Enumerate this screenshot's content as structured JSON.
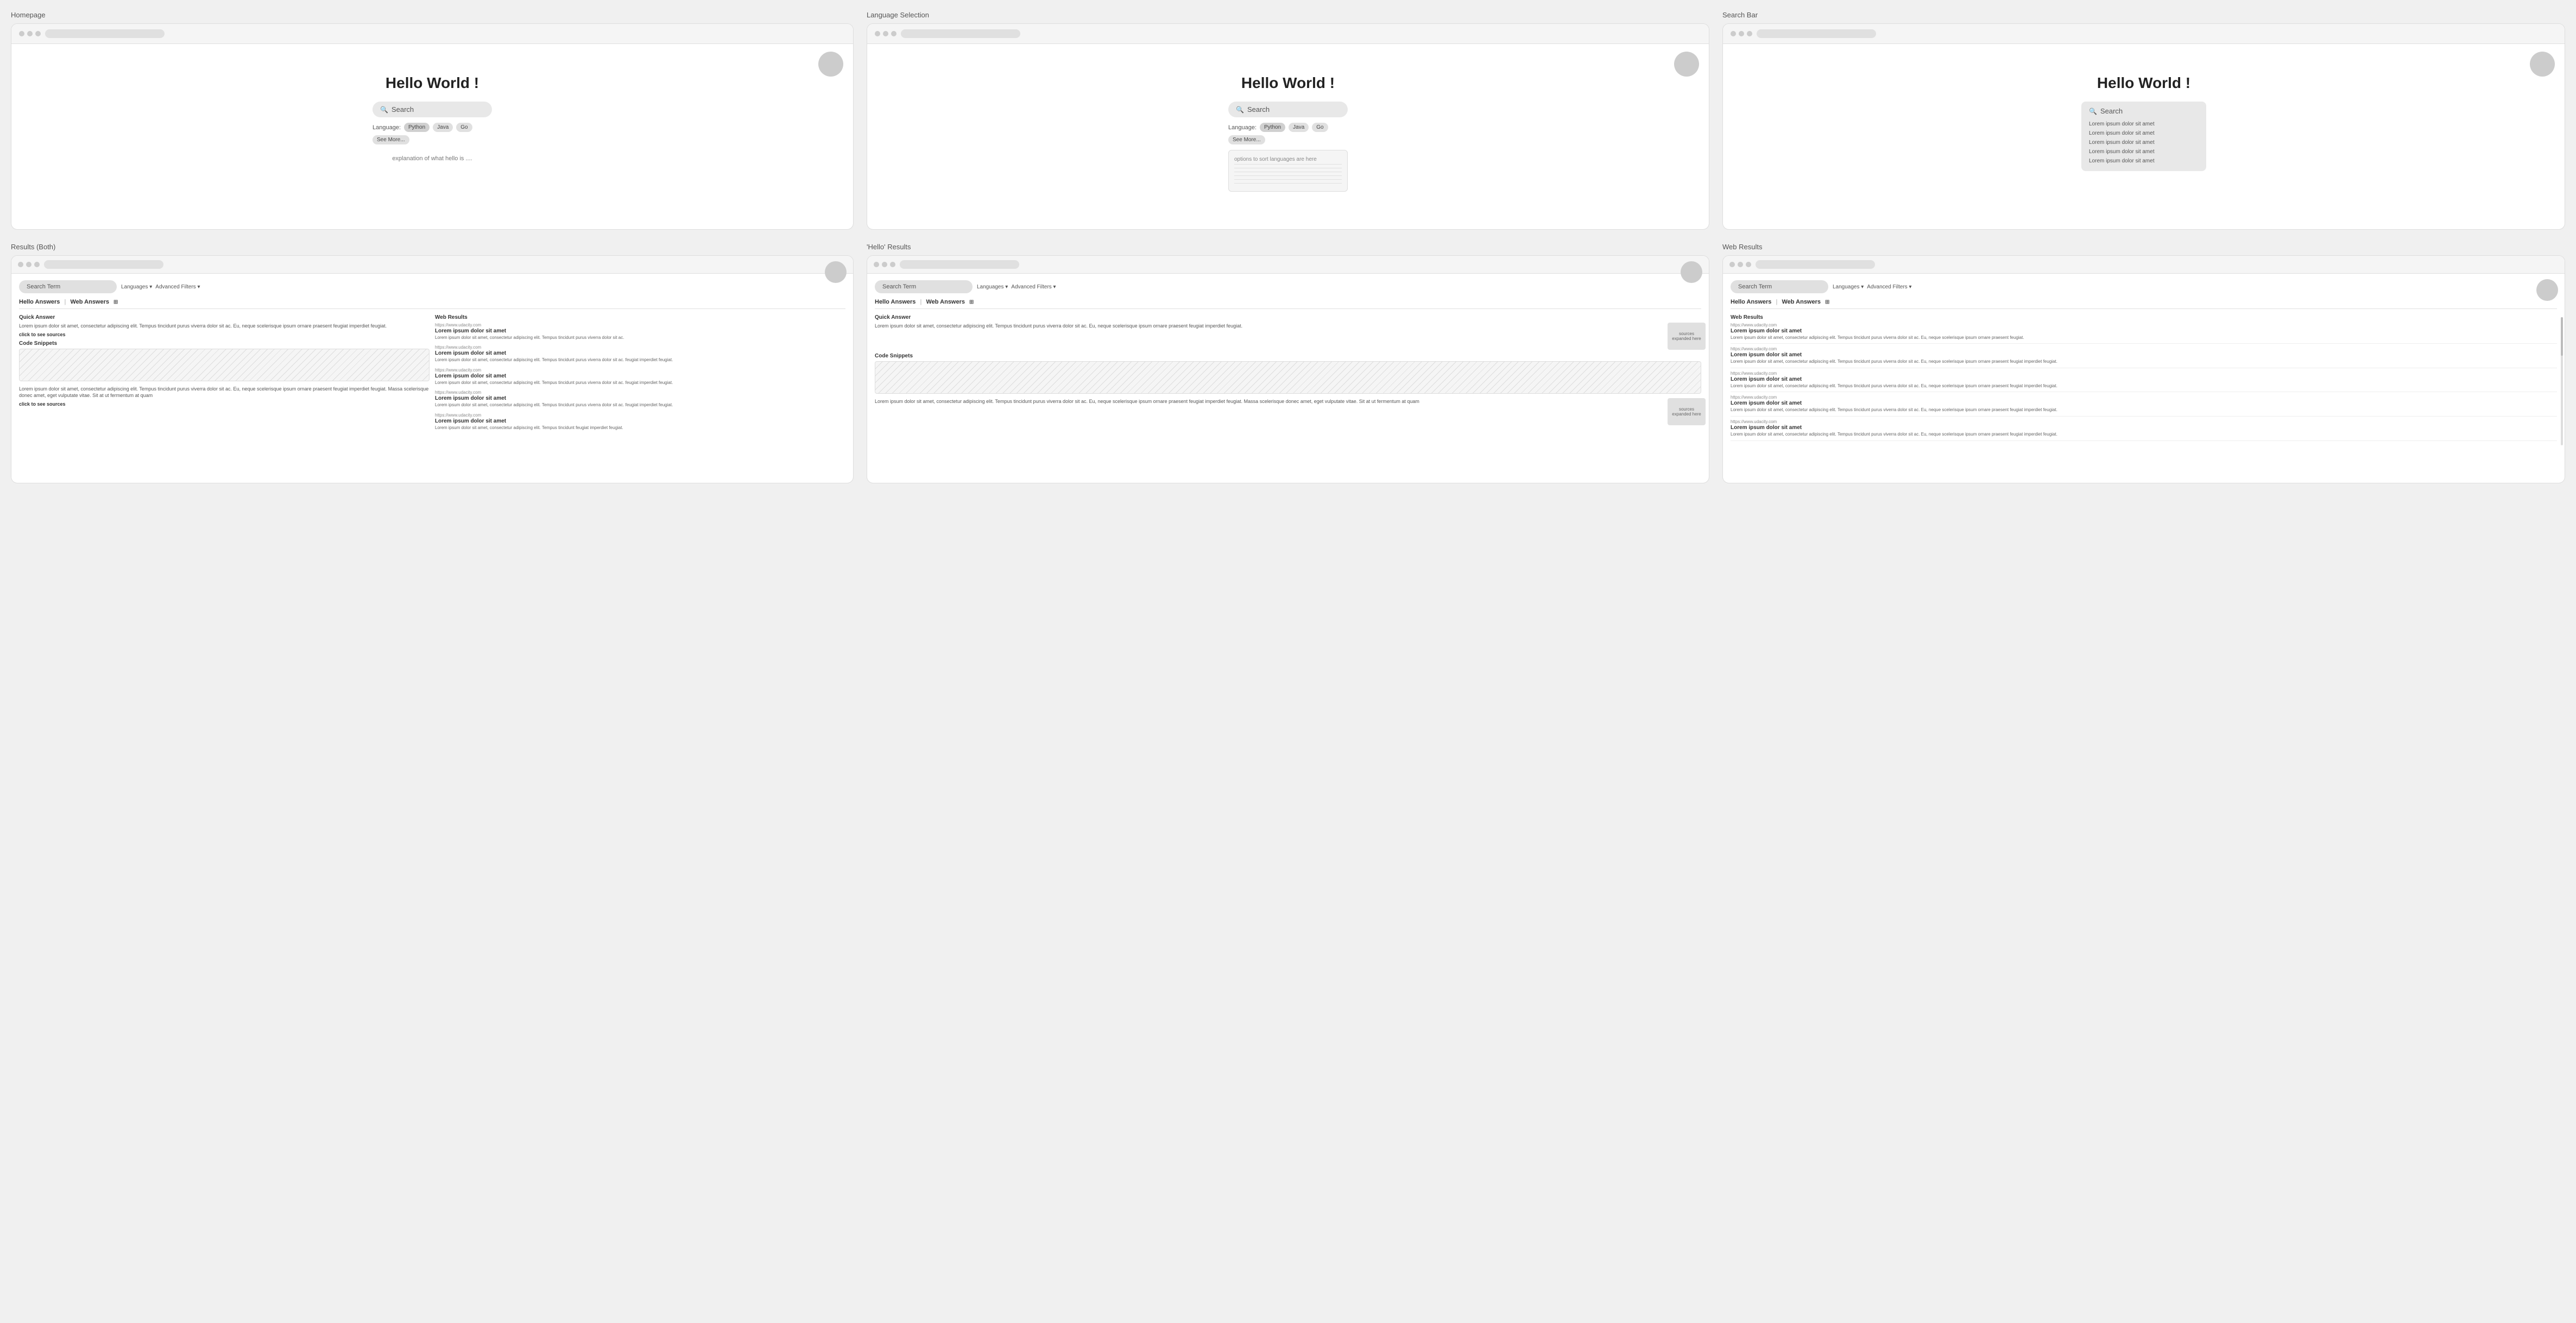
{
  "frames": [
    {
      "id": "homepage",
      "label": "Homepage",
      "type": "homepage",
      "heading": "Hello World !",
      "search": {
        "placeholder": "Search",
        "icon": "🔍"
      },
      "languages": {
        "label": "Language:",
        "tags": [
          "Python",
          "Java",
          "Go",
          "See More..."
        ]
      },
      "explanation": "explanation of what hello is ...."
    },
    {
      "id": "language-selection",
      "label": "Language Selection",
      "type": "language-selection",
      "heading": "Hello World !",
      "search": {
        "placeholder": "Search",
        "icon": "🔍"
      },
      "languages": {
        "label": "Language:",
        "tags": [
          "Python",
          "Java",
          "Go",
          "See More..."
        ]
      },
      "dropdown": {
        "placeholder": "options to sort languages are here",
        "options": [
          "",
          "",
          "",
          "",
          ""
        ]
      }
    },
    {
      "id": "search-bar",
      "label": "Search Bar",
      "type": "search-bar",
      "heading": "Hello World !",
      "search": {
        "placeholder": "Search",
        "icon": "🔍"
      },
      "autocomplete": [
        "Lorem ipsum dolor sit amet",
        "Lorem ipsum dolor sit amet",
        "Lorem ipsum dolor sit amet",
        "Lorem ipsum dolor sit amet",
        "Lorem ipsum dolor sit amet"
      ]
    },
    {
      "id": "results-both",
      "label": "Results (Both)",
      "type": "results-both",
      "searchTerm": "Search Term",
      "filters": {
        "languages": "Languages ▾",
        "advanced": "Advanced Filters ▾"
      },
      "tabs": [
        "Hello Answers",
        "Web Answers",
        "⊞"
      ],
      "leftColumn": {
        "quickAnswerTitle": "Quick Answer",
        "quickAnswerText": "Lorem ipsum dolor sit amet, consectetur adipiscing elit. Tempus tincidunt purus viverra dolor sit ac. Eu, neque scelerisque ipsum ornare praesent feugiat imperdiet feugiat.",
        "clickToSee": "click to see sources",
        "codeSnippetsTitle": "Code Snippets",
        "bottomText": "Lorem ipsum dolor sit amet, consectetur adipiscing elit. Tempus tincidunt purus viverra dolor sit ac. Eu, neque scelerisque ipsum ornare praesent feugiat imperdiet feugiat. Massa scelerisque donec amet, eget vulputate vitae. Sit at ut fermentum at quam",
        "bottomClick": "click to see sources"
      },
      "rightColumn": {
        "title": "Web Results",
        "items": [
          {
            "url": "https://www.udacity.com",
            "title": "Lorem ipsum dolor sit amet",
            "desc": "Lorem ipsum dolor sit amet, consectetur adipiscing elit. Tempus tincidunt purus viverra dolor sit ac."
          },
          {
            "url": "https://www.udacity.com",
            "title": "Lorem ipsum dolor sit amet",
            "desc": "Lorem ipsum dolor sit amet, consectetur adipiscing elit. Tempus tincidunt purus viverra dolor sit ac. feugiat imperdiet feugiat."
          },
          {
            "url": "https://www.udacity.com",
            "title": "Lorem ipsum dolor sit amet",
            "desc": "Lorem ipsum dolor sit amet, consectetur adipiscing elit. Tempus tincidunt purus viverra dolor sit ac. feugiat imperdiet feugiat."
          },
          {
            "url": "https://www.udacity.com",
            "title": "Lorem ipsum dolor sit amet",
            "desc": "Lorem ipsum dolor sit amet, consectetur adipiscing elit. Tempus tincidunt purus viverra dolor sit ac. feugiat imperdiet feugiat."
          },
          {
            "url": "https://www.udacity.com",
            "title": "Lorem ipsum dolor sit amet",
            "desc": "Lorem ipsum dolor sit amet, consectetur adipiscing elit. Tempus tincidunt feugiat imperdiet feugiat."
          }
        ]
      }
    },
    {
      "id": "hello-results",
      "label": "'Hello' Results",
      "type": "hello-results",
      "searchTerm": "Search Term",
      "filters": {
        "languages": "Languages ▾",
        "advanced": "Advanced Filters ▾"
      },
      "tabs": [
        "Hello Answers",
        "Web Answers",
        "⊞"
      ],
      "quickAnswerTitle": "Quick Answer",
      "quickAnswerText": "Lorem ipsum dolor sit amet, consectetur adipiscing elit. Tempus tincidunt purus viverra dolor sit ac. Eu, neque scelerisque ipsum ornare praesent feugiat imperdiet feugiat.",
      "sourcesExpanded1": "sources expanded here",
      "codeSnippetsTitle": "Code Snippets",
      "bottomText": "Lorem ipsum dolor sit amet, consectetur adipiscing elit. Tempus tincidunt purus viverra dolor sit ac. Eu, neque scelerisque ipsum ornare praesent feugiat imperdiet feugiat. Massa scelerisque donec amet, eget vulputate vitae. Sit at ut fermentum at quam",
      "sourcesExpanded2": "sources expanded here"
    },
    {
      "id": "web-results",
      "label": "Web Results",
      "type": "web-results",
      "searchTerm": "Search Term",
      "filters": {
        "languages": "Languages ▾",
        "advanced": "Advanced Filters ▾"
      },
      "tabs": [
        "Hello Answers",
        "Web Answers",
        "⊞"
      ],
      "webResultsTitle": "Web Results",
      "items": [
        {
          "url": "https://www.udacity.com",
          "title": "Lorem ipsum dolor sit amet",
          "desc": "Lorem ipsum dolor sit amet, consectetur adipiscing elit. Tempus tincidunt purus viverra dolor sit ac. Eu, neque scelerisque ipsum ornare praesent feugiat."
        },
        {
          "url": "https://www.udacity.com",
          "title": "Lorem ipsum dolor sit amet",
          "desc": "Lorem ipsum dolor sit amet, consectetur adipiscing elit. Tempus tincidunt purus viverra dolor sit ac. Eu, neque scelerisque ipsum ornare praesent feugiat imperdiet feugiat."
        },
        {
          "url": "https://www.udacity.com",
          "title": "Lorem ipsum dolor sit amet",
          "desc": "Lorem ipsum dolor sit amet, consectetur adipiscing elit. Tempus tincidunt purus viverra dolor sit ac. Eu, neque scelerisque ipsum ornare praesent feugiat imperdiet feugiat."
        },
        {
          "url": "https://www.udacity.com",
          "title": "Lorem ipsum dolor sit amet",
          "desc": "Lorem ipsum dolor sit amet, consectetur adipiscing elit. Tempus tincidunt purus viverra dolor sit ac. Eu, neque scelerisque ipsum ornare praesent feugiat imperdiet feugiat."
        },
        {
          "url": "https://www.udacity.com",
          "title": "Lorem ipsum dolor sit amet",
          "desc": "Lorem ipsum dolor sit amet, consectetur adipiscing elit. Tempus tincidunt purus viverra dolor sit ac. Eu, neque scelerisque ipsum ornare praesent feugiat imperdiet feugiat."
        }
      ]
    }
  ]
}
